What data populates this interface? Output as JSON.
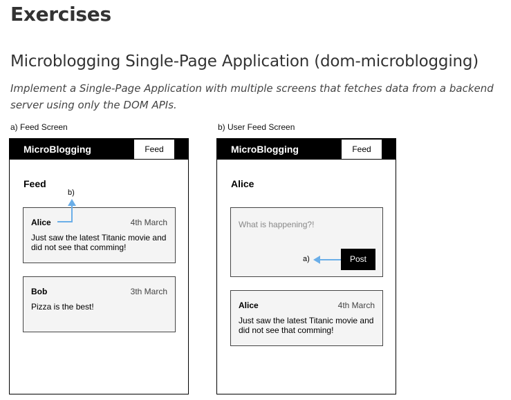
{
  "heading": "Exercises",
  "section": {
    "title": "Microblogging Single-Page Application (dom-microblogging)",
    "description": "Implement a Single-Page Application with multiple screens that fetches data from a backend server using only the DOM APIs."
  },
  "screens": [
    {
      "caption": "a) Feed Screen",
      "brand": "MicroBlogging",
      "nav_button": "Feed",
      "title": "Feed",
      "annotation": "b)",
      "posts": [
        {
          "author": "Alice",
          "date": "4th March",
          "text": "Just saw the latest Titanic movie and did not see that comming!"
        },
        {
          "author": "Bob",
          "date": "3th March",
          "text": "Pizza is the best!"
        }
      ]
    },
    {
      "caption": "b) User Feed Screen",
      "brand": "MicroBlogging",
      "nav_button": "Feed",
      "title": "Alice",
      "compose_placeholder": "What is happening?!",
      "post_button": "Post",
      "annotation": "a)",
      "posts": [
        {
          "author": "Alice",
          "date": "4th March",
          "text": "Just saw the latest Titanic movie and did not see that comming!"
        }
      ]
    }
  ],
  "colors": {
    "arrow": "#6aaee8",
    "card_bg": "#f4f4f4",
    "bar_bg": "#000000"
  }
}
